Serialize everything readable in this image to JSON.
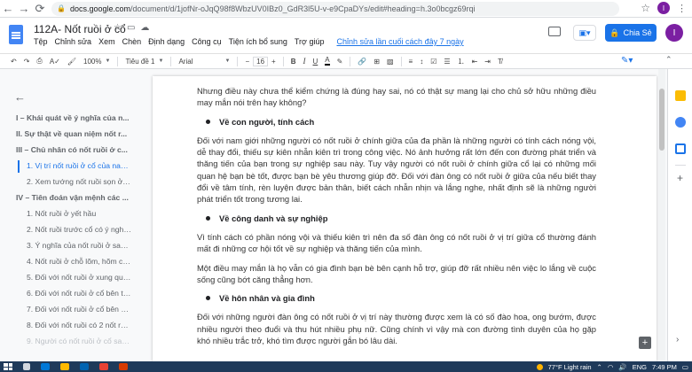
{
  "browser": {
    "url_domain": "docs.google.com",
    "url_path": "/document/d/1jofNr-oJqQ98f8WbzUV0IBz0_GdR3l5U-v-e9CpaDYs/edit#heading=h.3o0bcgz69rqi",
    "profile_initial": "I"
  },
  "docs": {
    "title": "112A- Nốt ruồi ở cổ",
    "menu": [
      "Tệp",
      "Chỉnh sửa",
      "Xem",
      "Chèn",
      "Định dạng",
      "Công cụ",
      "Tiện ích bổ sung",
      "Trợ giúp"
    ],
    "last_edit": "Chỉnh sửa lần cuối cách đây 7 ngày",
    "share_label": "Chia Sẻ",
    "user_initial": "I"
  },
  "toolbar": {
    "zoom": "100%",
    "style": "Tiêu đề 1",
    "font": "Arial",
    "font_size": "16"
  },
  "outline": {
    "items": [
      {
        "text": "I – Khái quát về ý nghĩa của n...",
        "level": 1
      },
      {
        "text": "II. Sự thật về quan niệm nốt r...",
        "level": 1
      },
      {
        "text": "III – Chủ nhân có nốt ruồi ở c...",
        "level": 1
      },
      {
        "text": "1. Vị trí nốt ruồi ở cổ của nam gi...",
        "level": 2,
        "active": true
      },
      {
        "text": "2. Xem tướng nốt ruồi sọn ở cổ ...",
        "level": 2
      },
      {
        "text": "IV – Tiên đoán vận mệnh các ...",
        "level": 1
      },
      {
        "text": "1. Nốt ruồi ở yết hầu",
        "level": 2
      },
      {
        "text": "2. Nốt ruồi trước cổ có ý nghĩa g...",
        "level": 2
      },
      {
        "text": "3. Ý nghĩa của nốt ruồi ở sau cổ?",
        "level": 2
      },
      {
        "text": "4. Nốt ruồi ở chỗ lõm, hõm cổ là...",
        "level": 2
      },
      {
        "text": "5. Đối với nốt ruồi ở xung quanh...",
        "level": 2
      },
      {
        "text": "6. Đối với nốt ruồi ở cổ bên trái",
        "level": 2
      },
      {
        "text": "7. Đối với nốt ruồi ở cổ bên phải...",
        "level": 2
      },
      {
        "text": "8. Đối với nốt ruồi có 2 nốt ruồi so...",
        "level": 2
      },
      {
        "text": "9. Người có nốt ruồi ở cổ sau tai...",
        "level": 2,
        "faded": true
      }
    ]
  },
  "content": {
    "p1": "Nhưng điều này chưa thể kiểm chứng là đúng hay sai, nó có thật sự mang lại cho chủ sở hữu những điều may mắn nói trên hay không?",
    "h1": "Về con người, tính cách",
    "p2": "Đối với nam giới những người có nốt ruồi ở chính giữa của đa phần là những người có tính cách nóng vội, dễ thay đổi, thiếu sự kiên nhẫn kiên trì trong công việc. Nó ảnh hưởng rất lớn đến con đường phát triển và thăng tiến của bạn trong sự nghiệp sau này. Tuy vậy người có nốt ruồi ở chính giữa cổ lại có những mối quan hệ bạn bè tốt, được bạn bè yêu thương giúp đỡ. Đối với đàn ông có nốt ruồi ở giữa của nếu biết thay đổi về tâm tính, rèn luyện được bản thân, biết cách nhẫn nhịn và lắng nghe, nhất định sẽ là những người phát triển tốt trong tương lai.",
    "h2": "Về công danh và sự nghiệp",
    "p3": "Vì tính cách có phần nóng vội và thiếu kiên trì nên đa số đàn ông có nốt ruồi ở vị trí giữa cổ thường đánh mất đi những cơ hội tốt về sự nghiệp và thăng tiến của mình.",
    "p4": "Một điều may mắn là họ vẫn có gia đình bạn bè bên cạnh hỗ trợ, giúp đỡ rất nhiều nên việc lo lắng về cuộc sống cũng bớt căng thẳng hơn.",
    "h3": "Về hôn nhân và gia đình",
    "p5": "Đối với những người đàn ông có nốt ruồi ở vị trí này thường được xem là có số đào hoa, ong bướm, được nhiều người theo đuổi và thu hút nhiều phụ nữ. Cũng chính vì vậy mà con đường tình duyên của họ gặp khó nhiều trắc trở, khó tìm được người gắn bó lâu dài."
  },
  "taskbar": {
    "weather": "77°F  Light rain",
    "lang": "ENG",
    "time": "7:49 PM"
  }
}
